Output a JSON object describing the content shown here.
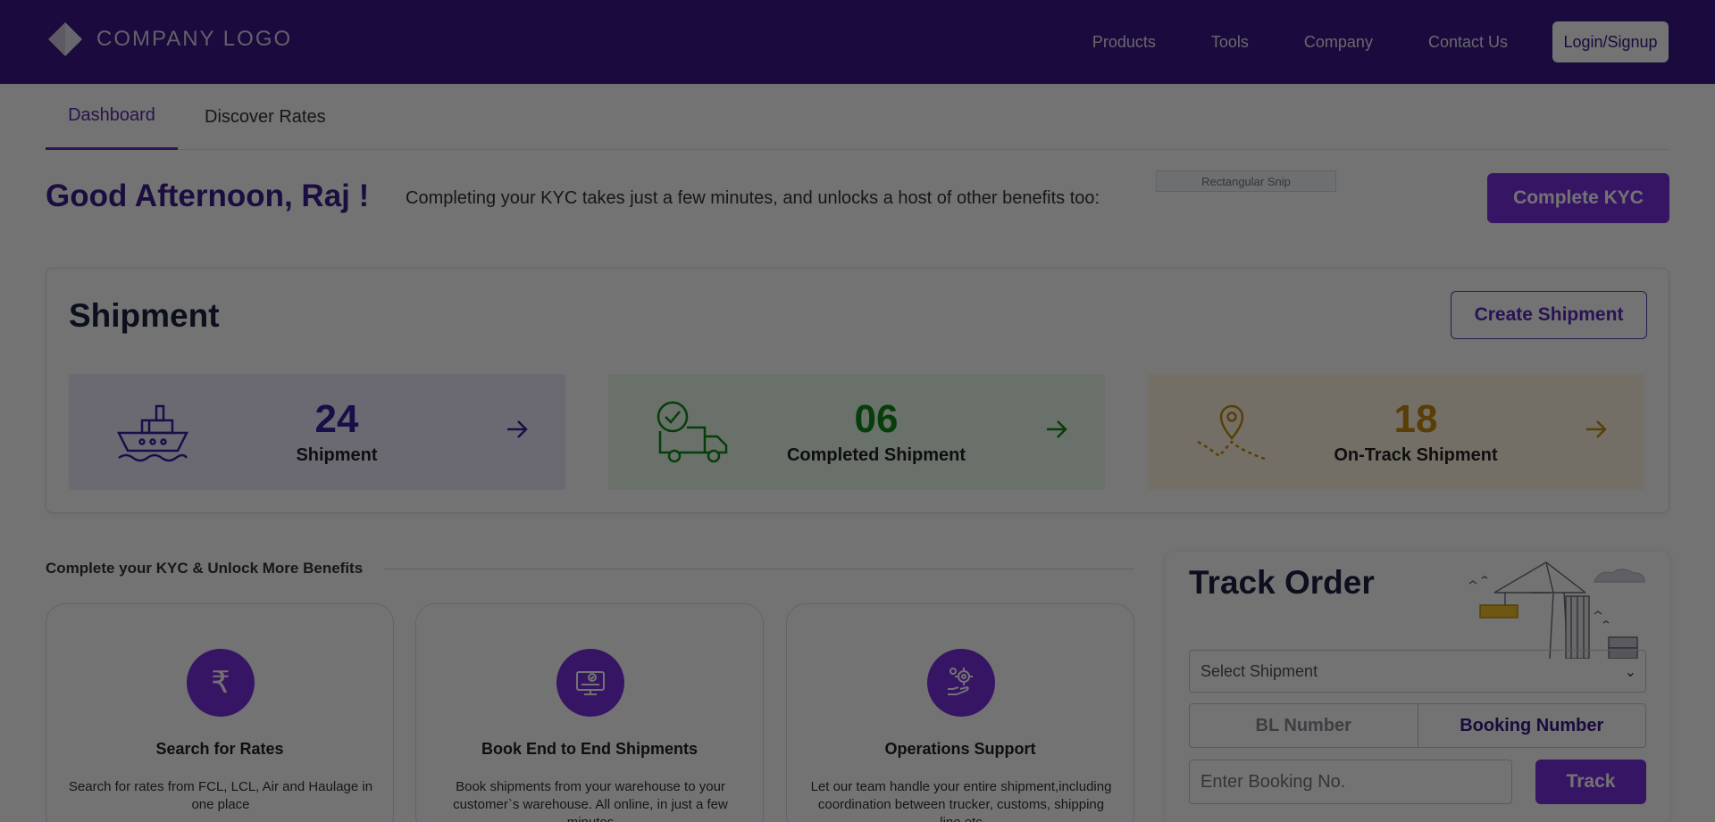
{
  "header": {
    "logo_text": "COMPANY LOGO",
    "nav": [
      "Products",
      "Tools",
      "Company",
      "Contact Us"
    ],
    "login_label": "Login/Signup"
  },
  "tabs": [
    {
      "label": "Dashboard",
      "active": true
    },
    {
      "label": "Discover Rates",
      "active": false
    }
  ],
  "greeting": "Good Afternoon, Raj !",
  "kyc_prompt": "Completing your KYC takes just a few minutes, and unlocks a host of other benefits too:",
  "snip_label": "Rectangular Snip",
  "complete_kyc_label": "Complete KYC",
  "shipment": {
    "title": "Shipment",
    "create_label": "Create Shipment",
    "stats": [
      {
        "value": "24",
        "label": "Shipment",
        "color": "#3a1fa0",
        "bg": "#eeeaff",
        "icon": "ship-icon"
      },
      {
        "value": "06",
        "label": "Completed Shipment",
        "color": "#0f8a1a",
        "bg": "#eaf8ea",
        "icon": "truck-check-icon"
      },
      {
        "value": "18",
        "label": "On-Track Shipment",
        "color": "#c88a12",
        "bg": "#fff6e2",
        "icon": "map-pin-route-icon"
      }
    ]
  },
  "kyc_section": {
    "heading": "Complete your KYC & Unlock More Benefits",
    "benefits": [
      {
        "title": "Search for Rates",
        "desc": "Search for rates from FCL, LCL, Air and Haulage in one place",
        "icon": "rupee-icon"
      },
      {
        "title": "Book End to End Shipments",
        "desc": "Book shipments from your warehouse to your customer`s warehouse. All online, in just a few minutes",
        "icon": "monitor-check-icon"
      },
      {
        "title": "Operations Support",
        "desc": "Let our team handle your entire shipment,including coordination between trucker, customs, shipping line etc",
        "icon": "gear-hand-icon"
      }
    ]
  },
  "track": {
    "title": "Track Order",
    "select_placeholder": "Select Shipment",
    "toggle": [
      "BL Number",
      "Booking Number"
    ],
    "active_toggle": "Booking Number",
    "input_placeholder": "Enter Booking No.",
    "track_label": "Track"
  }
}
